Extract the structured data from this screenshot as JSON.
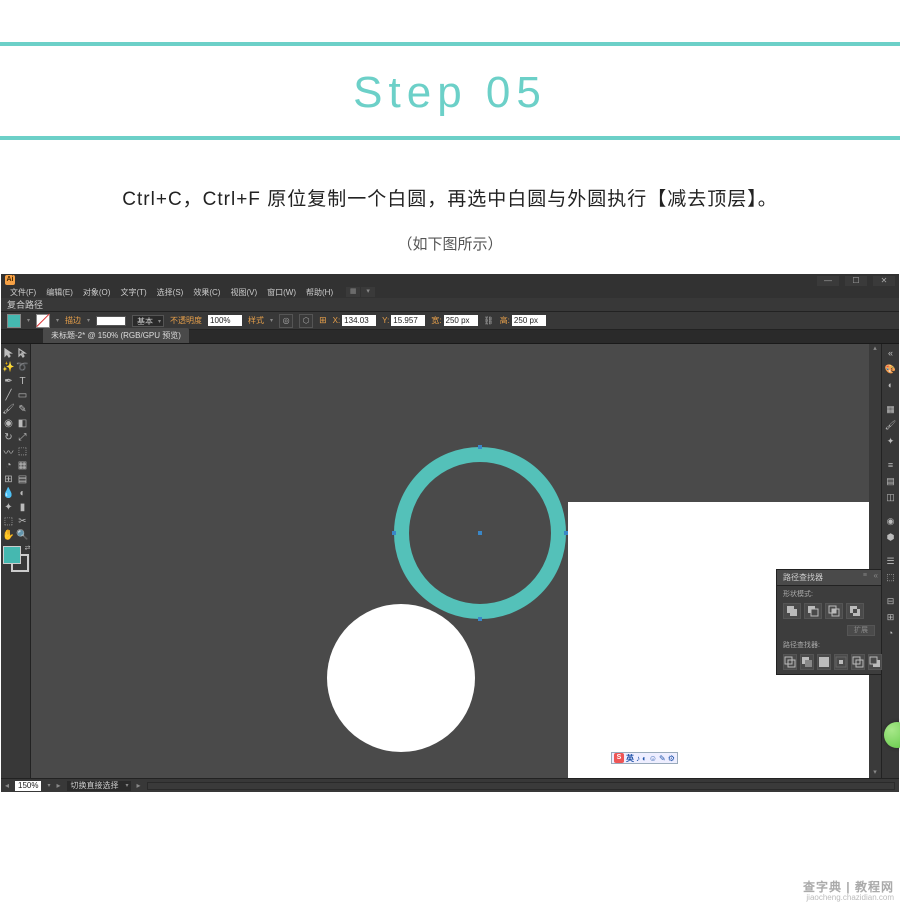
{
  "step": {
    "title": "Step 05",
    "instruction": "Ctrl+C，Ctrl+F 原位复制一个白圆，再选中白圆与外圆执行【减去顶层】。",
    "sub": "（如下图所示）"
  },
  "colors": {
    "accent": "#6cd0c8",
    "teal": "#54c1b9"
  },
  "ai": {
    "logo": "Ai",
    "menu": [
      "文件(F)",
      "编辑(E)",
      "对象(O)",
      "文字(T)",
      "选择(S)",
      "效果(C)",
      "视图(V)",
      "窗口(W)",
      "帮助(H)"
    ],
    "compound_label": "复合路径",
    "options": {
      "stroke_label": "描边",
      "stroke_dd": "基本",
      "opacity_label": "不透明度",
      "opacity_val": "100%",
      "style_label": "样式",
      "x_val": "134.03",
      "y_val": "15.957",
      "w_val": "250 px",
      "h_val": "250 px",
      "unit": "px"
    },
    "doc_tab": "未标题-2* @ 150% (RGB/GPU 预览)",
    "pathfinder": {
      "tab": "路径查找器",
      "section1": "形状模式:",
      "section2": "路径查找器:",
      "expand": "扩展"
    },
    "status": {
      "zoom": "150%",
      "info": "切换直接选择"
    },
    "ime": {
      "s": "S",
      "text": "英",
      "icons": [
        "♪",
        "◐",
        "☺",
        "✎",
        "⚙"
      ]
    },
    "win_controls": [
      "—",
      "☐",
      "✕"
    ]
  },
  "watermark": {
    "main": "查字典 | 教程网",
    "sub": "jiaocheng.chazidian.com"
  }
}
